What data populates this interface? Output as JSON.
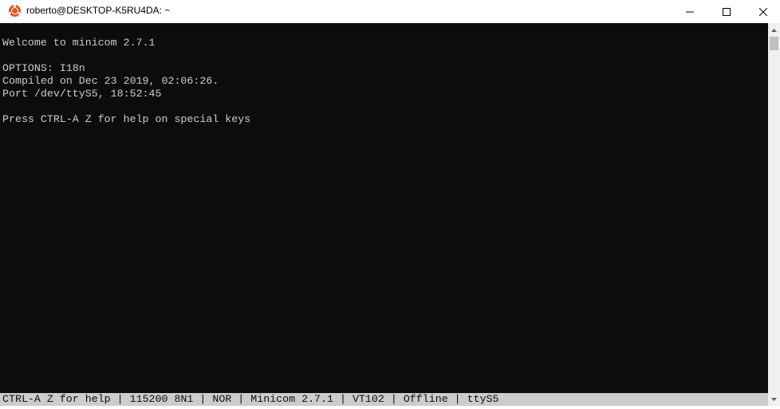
{
  "window": {
    "title": "roberto@DESKTOP-K5RU4DA: ~",
    "icon": "ubuntu-icon",
    "controls": {
      "minimize": "minimize-icon",
      "maximize": "maximize-icon",
      "close": "close-icon"
    }
  },
  "terminal": {
    "lines": [
      "Welcome to minicom 2.7.1",
      "OPTIONS: I18n",
      "Compiled on Dec 23 2019, 02:06:26.",
      "Port /dev/ttyS5, 18:52:45",
      "Press CTRL-A Z for help on special keys"
    ]
  },
  "statusbar": {
    "help": "CTRL-A Z for help",
    "baud": "115200 8N1",
    "mode": "NOR",
    "version": "Minicom 2.7.1",
    "terminal_type": "VT102",
    "connection": "Offline",
    "port": "ttyS5",
    "separator": " | "
  },
  "colors": {
    "terminal_bg": "#0c0c0c",
    "terminal_fg": "#cccccc",
    "statusbar_bg": "#cccccc",
    "ubuntu_orange": "#e95420"
  }
}
